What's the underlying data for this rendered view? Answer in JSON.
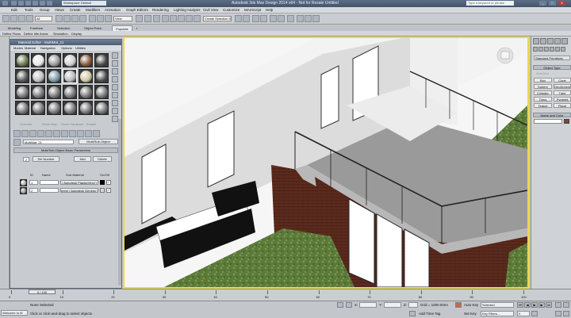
{
  "window": {
    "title": "Autodesk 3ds Max Design 2014 x64  -  Not for Resale   Untitled",
    "workspace": "Workspace: Default",
    "search_placeholder": "Type a keyword or phrase",
    "minimize": "_",
    "maximize": "□",
    "close": "✕"
  },
  "menu": [
    "Edit",
    "Tools",
    "Group",
    "Views",
    "Create",
    "Modifiers",
    "Animation",
    "Graph Editors",
    "Rendering",
    "Lighting Analysis",
    "Civil View",
    "Customize",
    "MAXScript",
    "Help"
  ],
  "toolbar": {
    "filter": "All",
    "view": "View",
    "selection_set": "Create Selection Se"
  },
  "ribbon": {
    "tabs": [
      "Modeling",
      "Freeform",
      "Selection",
      "Object Paint",
      "Populate"
    ],
    "active_tab": "Populate",
    "subtabs": [
      "Define Flows",
      "Define Idle Areas",
      "Simulation",
      "Display"
    ]
  },
  "material_editor": {
    "title": "Material Editor - MultiMat_21",
    "menu": [
      "Modes",
      "Material",
      "Navigation",
      "Options",
      "Utilities"
    ],
    "greyed_labels": [
      "Override",
      "Show Map",
      "Show Hardware",
      "Enable"
    ],
    "material_name": "MultiMat_21",
    "material_type": "Multi/Sub-Object",
    "rollout_title": "Multi/Sub-Object Basic Parameters",
    "set_number": "Set Number",
    "set_number_value": "2",
    "add": "Add",
    "delete": "Delete",
    "columns": [
      "ID",
      "Name",
      "Sub-Material",
      "On/Off"
    ],
    "rows": [
      {
        "id": "1",
        "name": "",
        "sub_material": "( Autodesk Plastic/Vinyl )"
      },
      {
        "id": "2",
        "name": "",
        "sub_material": "none ( Autodesk Generic )"
      }
    ]
  },
  "command_panel": {
    "dropdown": "Standard Primitives",
    "object_type": "Object Type",
    "autogrid": "AutoGrid",
    "buttons": [
      [
        "Box",
        "Cone"
      ],
      [
        "Sphere",
        "GeoSphere"
      ],
      [
        "Cylinder",
        "Tube"
      ],
      [
        "Torus",
        "Pyramid"
      ],
      [
        "Teapot",
        "Plane"
      ]
    ],
    "name_and_color": "Name and Color"
  },
  "timeline": {
    "slider": "0 / 100",
    "ticks": [
      "0",
      "10",
      "20",
      "30",
      "40",
      "50",
      "60",
      "70",
      "80",
      "90",
      "100"
    ]
  },
  "status": {
    "welcome": "Welcome to M",
    "none_selected": "None Selected",
    "prompt": "Click or click-and-drag to select objects",
    "x_label": "X:",
    "y_label": "Y:",
    "z_label": "Z:",
    "grid": "Grid = 1000.0mm",
    "add_time_tag": "Add Time Tag",
    "auto_key": "Auto Key",
    "auto_key_value": "Selected",
    "set_key": "Set Key",
    "key_filters": "Key Filters...",
    "frame": "0"
  }
}
